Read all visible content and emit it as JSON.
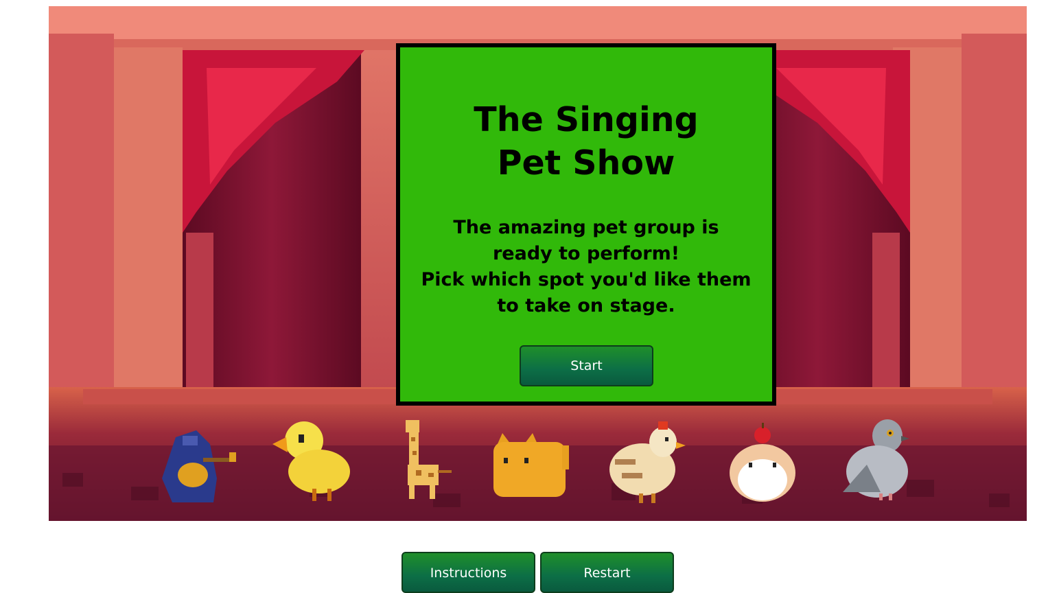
{
  "game": {
    "title": "The Singing Pet Show",
    "message_line1": "The amazing pet group is ready to perform!",
    "message_line2": "Pick which spot you'd like them to take on stage.",
    "start_label": "Start"
  },
  "controls": {
    "instructions_label": "Instructions",
    "restart_label": "Restart"
  },
  "pets": [
    "gorilla-guitarist",
    "duck",
    "giraffe",
    "cat",
    "chicken",
    "hamster",
    "pigeon"
  ],
  "colors": {
    "dialog_bg": "#31b90a",
    "button_top": "#1f8f2a",
    "button_bottom": "#0a5a3e",
    "curtain": "#8a1030",
    "floor": "#7a1e38"
  }
}
